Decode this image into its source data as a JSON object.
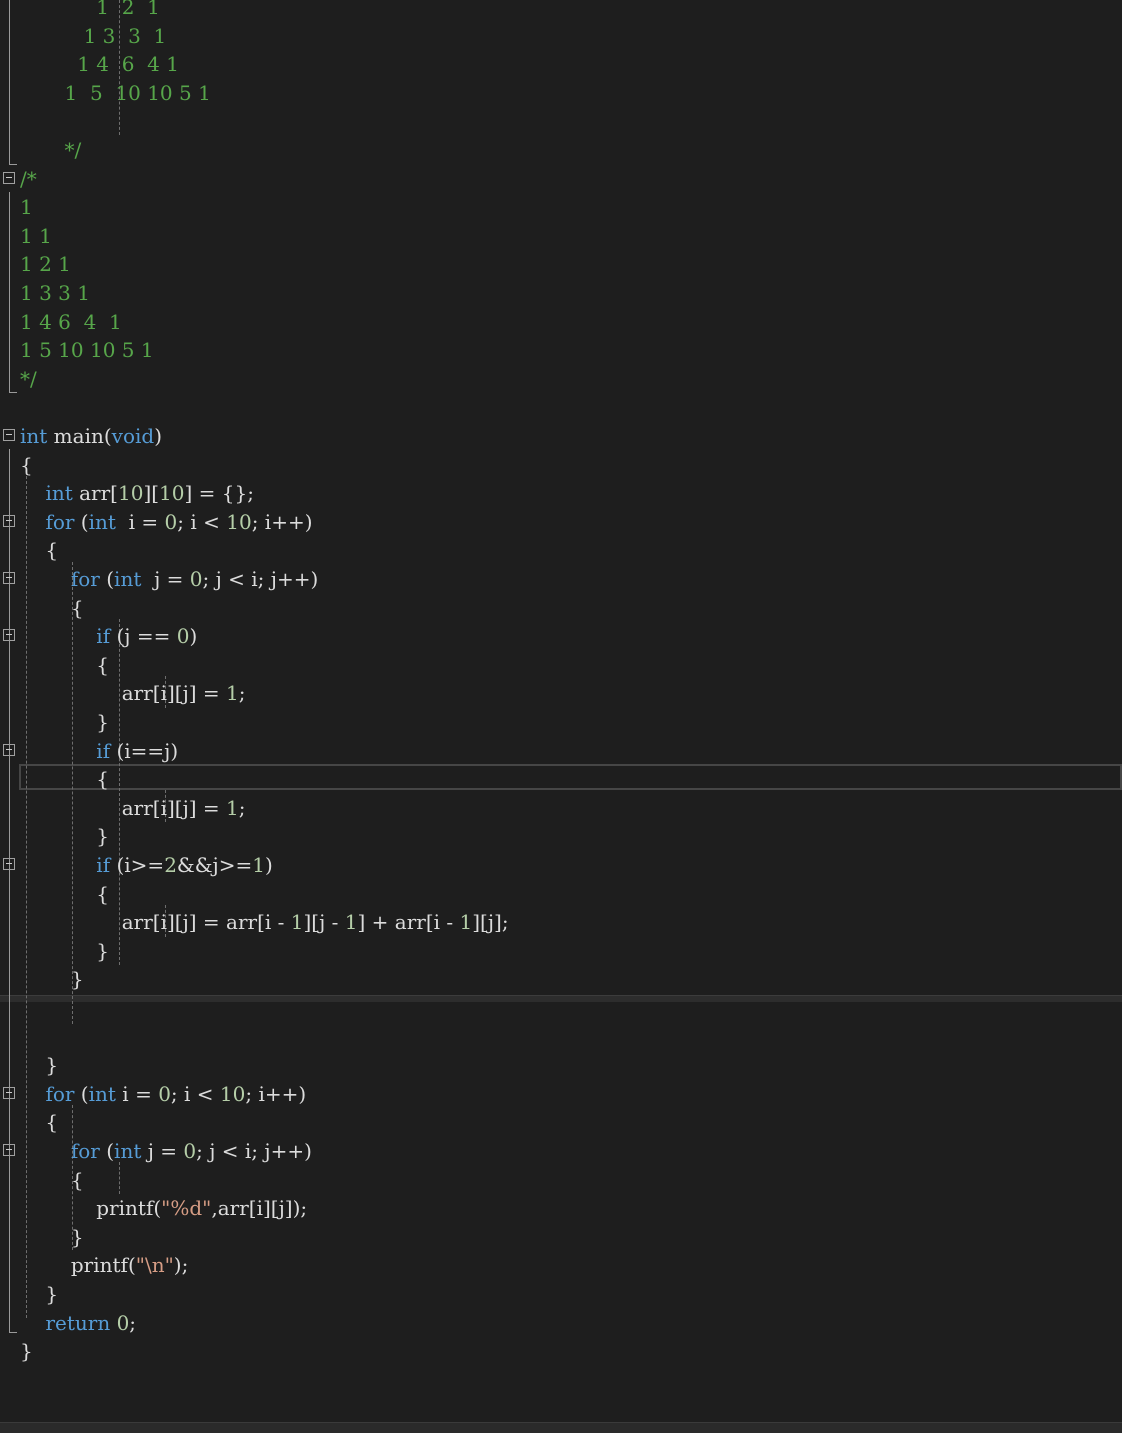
{
  "editor": {
    "colors": {
      "background": "#1e1e1e",
      "keyword": "#569cd6",
      "comment": "#57a64a",
      "number": "#b5cea8",
      "string": "#d69d85",
      "text": "#dcdcdc"
    },
    "lines": [
      {
        "tokens": [
          {
            "t": "cm",
            "v": "            1  2  1"
          }
        ]
      },
      {
        "tokens": [
          {
            "t": "cm",
            "v": "          1 3  3  1"
          }
        ]
      },
      {
        "tokens": [
          {
            "t": "cm",
            "v": "         1 4  6  4 1"
          }
        ]
      },
      {
        "tokens": [
          {
            "t": "cm",
            "v": "       1  5  10 10 5 1"
          }
        ]
      },
      {
        "tokens": [
          {
            "t": "cm",
            "v": ""
          }
        ]
      },
      {
        "tokens": [
          {
            "t": "cm",
            "v": "       */"
          }
        ]
      },
      {
        "fold": true,
        "tokens": [
          {
            "t": "cm",
            "v": "/*"
          }
        ]
      },
      {
        "tokens": [
          {
            "t": "cm",
            "v": "1"
          }
        ]
      },
      {
        "tokens": [
          {
            "t": "cm",
            "v": "1 1"
          }
        ]
      },
      {
        "tokens": [
          {
            "t": "cm",
            "v": "1 2 1"
          }
        ]
      },
      {
        "tokens": [
          {
            "t": "cm",
            "v": "1 3 3 1"
          }
        ]
      },
      {
        "tokens": [
          {
            "t": "cm",
            "v": "1 4 6  4  1"
          }
        ]
      },
      {
        "tokens": [
          {
            "t": "cm",
            "v": "1 5 10 10 5 1"
          }
        ]
      },
      {
        "tokens": [
          {
            "t": "cm",
            "v": "*/"
          }
        ]
      },
      {
        "tokens": []
      },
      {
        "fold": true,
        "tokens": [
          {
            "t": "kw",
            "v": "int"
          },
          {
            "t": "tx",
            "v": " main("
          },
          {
            "t": "kw",
            "v": "void"
          },
          {
            "t": "tx",
            "v": ")"
          }
        ]
      },
      {
        "tokens": [
          {
            "t": "tx",
            "v": "{"
          }
        ]
      },
      {
        "tokens": [
          {
            "t": "tx",
            "v": "    "
          },
          {
            "t": "kw",
            "v": "int"
          },
          {
            "t": "tx",
            "v": " arr["
          },
          {
            "t": "num",
            "v": "10"
          },
          {
            "t": "tx",
            "v": "]["
          },
          {
            "t": "num",
            "v": "10"
          },
          {
            "t": "tx",
            "v": "] = {};"
          }
        ]
      },
      {
        "fold": true,
        "tokens": [
          {
            "t": "tx",
            "v": "    "
          },
          {
            "t": "kw",
            "v": "for"
          },
          {
            "t": "tx",
            "v": " ("
          },
          {
            "t": "kw",
            "v": "int"
          },
          {
            "t": "tx",
            "v": "  i = "
          },
          {
            "t": "num",
            "v": "0"
          },
          {
            "t": "tx",
            "v": "; i < "
          },
          {
            "t": "num",
            "v": "10"
          },
          {
            "t": "tx",
            "v": "; i++)"
          }
        ]
      },
      {
        "tokens": [
          {
            "t": "tx",
            "v": "    {"
          }
        ]
      },
      {
        "fold": true,
        "tokens": [
          {
            "t": "tx",
            "v": "        "
          },
          {
            "t": "kw",
            "v": "for"
          },
          {
            "t": "tx",
            "v": " ("
          },
          {
            "t": "kw",
            "v": "int"
          },
          {
            "t": "tx",
            "v": "  j = "
          },
          {
            "t": "num",
            "v": "0"
          },
          {
            "t": "tx",
            "v": "; j < i; j++)"
          }
        ]
      },
      {
        "tokens": [
          {
            "t": "tx",
            "v": "        {"
          }
        ]
      },
      {
        "fold": true,
        "tokens": [
          {
            "t": "tx",
            "v": "            "
          },
          {
            "t": "kw",
            "v": "if"
          },
          {
            "t": "tx",
            "v": " (j == "
          },
          {
            "t": "num",
            "v": "0"
          },
          {
            "t": "tx",
            "v": ")"
          }
        ]
      },
      {
        "tokens": [
          {
            "t": "tx",
            "v": "            {"
          }
        ]
      },
      {
        "tokens": [
          {
            "t": "tx",
            "v": "                arr[i][j] = "
          },
          {
            "t": "num",
            "v": "1"
          },
          {
            "t": "tx",
            "v": ";"
          }
        ]
      },
      {
        "tokens": [
          {
            "t": "tx",
            "v": "            }"
          }
        ]
      },
      {
        "fold": true,
        "tokens": [
          {
            "t": "tx",
            "v": "            "
          },
          {
            "t": "kw",
            "v": "if"
          },
          {
            "t": "tx",
            "v": " (i==j)"
          }
        ]
      },
      {
        "tokens": [
          {
            "t": "tx",
            "v": "            {"
          }
        ]
      },
      {
        "tokens": [
          {
            "t": "tx",
            "v": "                arr[i][j] = "
          },
          {
            "t": "num",
            "v": "1"
          },
          {
            "t": "tx",
            "v": ";"
          }
        ]
      },
      {
        "tokens": [
          {
            "t": "tx",
            "v": "            }"
          }
        ]
      },
      {
        "fold": true,
        "tokens": [
          {
            "t": "tx",
            "v": "            "
          },
          {
            "t": "kw",
            "v": "if"
          },
          {
            "t": "tx",
            "v": " (i>="
          },
          {
            "t": "num",
            "v": "2"
          },
          {
            "t": "tx",
            "v": "&&j>="
          },
          {
            "t": "num",
            "v": "1"
          },
          {
            "t": "tx",
            "v": ")"
          }
        ]
      },
      {
        "tokens": [
          {
            "t": "tx",
            "v": "            {"
          }
        ]
      },
      {
        "tokens": [
          {
            "t": "tx",
            "v": "                arr[i][j] = arr[i - "
          },
          {
            "t": "num",
            "v": "1"
          },
          {
            "t": "tx",
            "v": "][j - "
          },
          {
            "t": "num",
            "v": "1"
          },
          {
            "t": "tx",
            "v": "] + arr[i - "
          },
          {
            "t": "num",
            "v": "1"
          },
          {
            "t": "tx",
            "v": "][j];"
          }
        ]
      },
      {
        "tokens": [
          {
            "t": "tx",
            "v": "            }"
          }
        ]
      },
      {
        "tokens": [
          {
            "t": "tx",
            "v": "        }"
          }
        ]
      },
      {
        "tokens": []
      },
      {
        "tokens": []
      },
      {
        "tokens": [
          {
            "t": "tx",
            "v": "    }"
          }
        ]
      },
      {
        "fold": true,
        "tokens": [
          {
            "t": "tx",
            "v": "    "
          },
          {
            "t": "kw",
            "v": "for"
          },
          {
            "t": "tx",
            "v": " ("
          },
          {
            "t": "kw",
            "v": "int"
          },
          {
            "t": "tx",
            "v": " i = "
          },
          {
            "t": "num",
            "v": "0"
          },
          {
            "t": "tx",
            "v": "; i < "
          },
          {
            "t": "num",
            "v": "10"
          },
          {
            "t": "tx",
            "v": "; i++)"
          }
        ]
      },
      {
        "tokens": [
          {
            "t": "tx",
            "v": "    {"
          }
        ]
      },
      {
        "fold": true,
        "tokens": [
          {
            "t": "tx",
            "v": "        "
          },
          {
            "t": "kw",
            "v": "for"
          },
          {
            "t": "tx",
            "v": " ("
          },
          {
            "t": "kw",
            "v": "int"
          },
          {
            "t": "tx",
            "v": " j = "
          },
          {
            "t": "num",
            "v": "0"
          },
          {
            "t": "tx",
            "v": "; j < i; j++)"
          }
        ]
      },
      {
        "tokens": [
          {
            "t": "tx",
            "v": "        {"
          }
        ]
      },
      {
        "tokens": [
          {
            "t": "tx",
            "v": "            printf("
          },
          {
            "t": "str",
            "v": "\"%d\""
          },
          {
            "t": "tx",
            "v": ",arr[i][j]);"
          }
        ]
      },
      {
        "tokens": [
          {
            "t": "tx",
            "v": "        }"
          }
        ]
      },
      {
        "tokens": [
          {
            "t": "tx",
            "v": "        printf("
          },
          {
            "t": "str",
            "v": "\"\\n\""
          },
          {
            "t": "tx",
            "v": ");"
          }
        ]
      },
      {
        "tokens": [
          {
            "t": "tx",
            "v": "    }"
          }
        ]
      },
      {
        "tokens": [
          {
            "t": "tx",
            "v": "    "
          },
          {
            "t": "kw",
            "v": "return"
          },
          {
            "t": "tx",
            "v": " "
          },
          {
            "t": "num",
            "v": "0"
          },
          {
            "t": "tx",
            "v": ";"
          }
        ]
      },
      {
        "tokens": [
          {
            "t": "tx",
            "v": "}"
          }
        ]
      }
    ]
  }
}
